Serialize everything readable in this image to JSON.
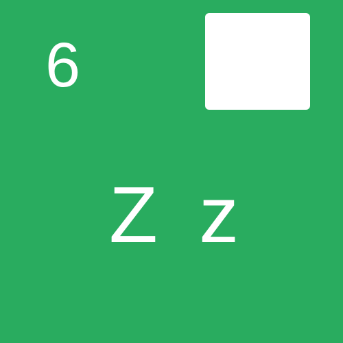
{
  "card": {
    "number": "6",
    "letters": "Z z",
    "colors": {
      "background": "#29ac5f",
      "foreground": "#ffffff"
    }
  }
}
